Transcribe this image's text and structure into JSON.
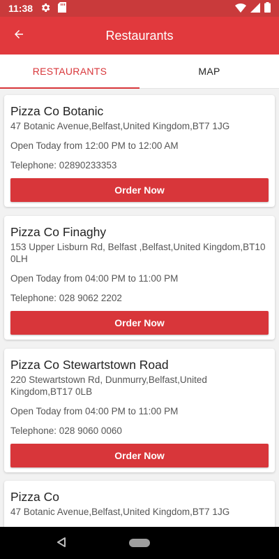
{
  "status_bar": {
    "time": "11:38",
    "icons": [
      "gear-icon",
      "sd-card-icon",
      "wifi-icon",
      "signal-icon",
      "battery-icon"
    ]
  },
  "app_bar": {
    "title": "Restaurants",
    "back_icon": "arrow-left-icon"
  },
  "tabs": [
    {
      "label": "RESTAURANTS",
      "active": true
    },
    {
      "label": "MAP",
      "active": false
    }
  ],
  "restaurants": [
    {
      "name": "Pizza Co Botanic",
      "address": "47 Botanic Avenue,Belfast,United Kingdom,BT7 1JG",
      "hours": "Open Today from 12:00 PM to 12:00 AM",
      "telephone": "Telephone: 02890233353",
      "button": "Order Now"
    },
    {
      "name": "Pizza Co Finaghy",
      "address": "153 Upper Lisburn Rd, Belfast ,Belfast,United Kingdom,BT10 0LH",
      "hours": "Open Today from 04:00 PM to 11:00 PM",
      "telephone": "Telephone: 028 9062 2202",
      "button": "Order Now"
    },
    {
      "name": "Pizza Co Stewartstown Road",
      "address": "220 Stewartstown Rd, Dunmurry,Belfast,United Kingdom,BT17 0LB",
      "hours": "Open Today from 04:00 PM to 11:00 PM",
      "telephone": "Telephone: 028 9060 0060",
      "button": "Order Now"
    },
    {
      "name": "Pizza Co",
      "address": "47 Botanic Avenue,Belfast,United Kingdom,BT7 1JG",
      "hours": "",
      "telephone": "",
      "button": ""
    }
  ],
  "nav_bar": {
    "icons": [
      "back-triangle-icon",
      "home-pill-icon"
    ]
  },
  "colors": {
    "primary": "#e1393d",
    "status_bar": "#c93a3b",
    "button": "#d8363a"
  }
}
